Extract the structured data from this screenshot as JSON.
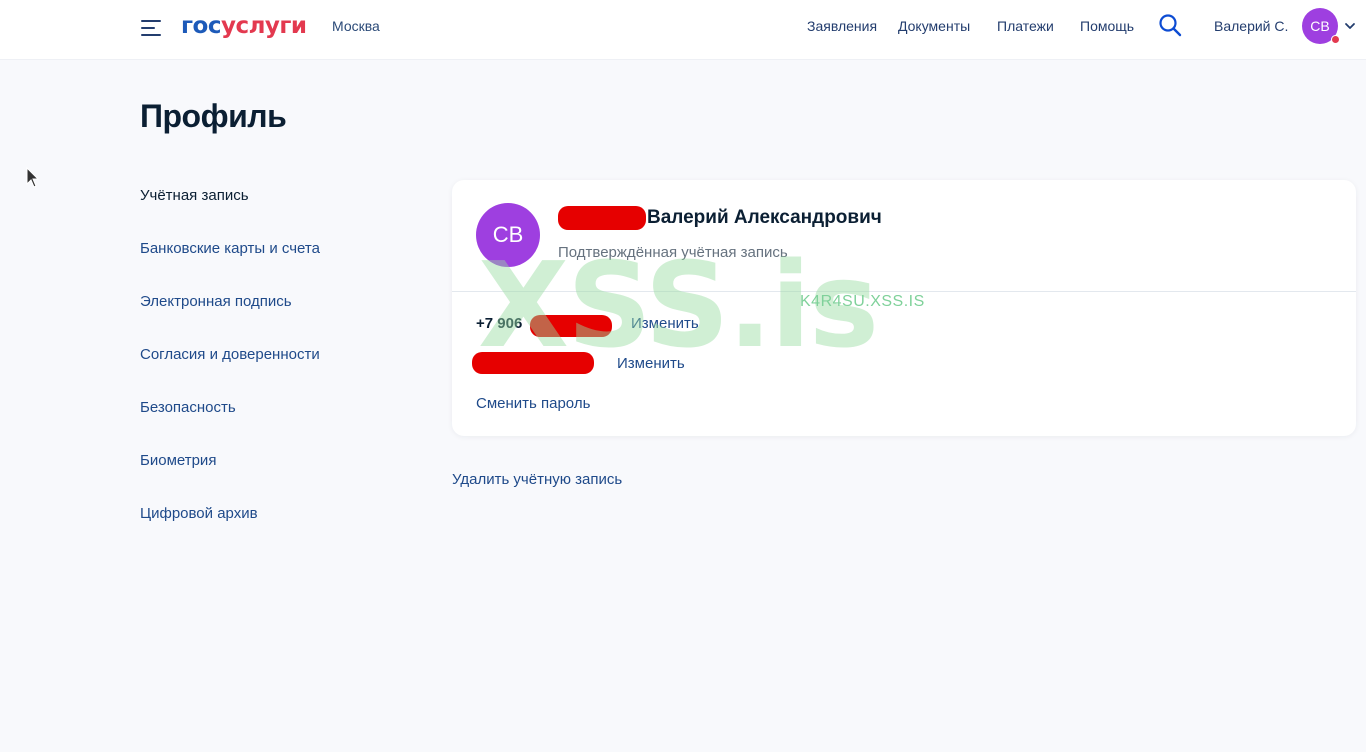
{
  "header": {
    "logo_part1": "гос",
    "logo_part2": "услуги",
    "city": "Москва",
    "nav": [
      "Заявления",
      "Документы",
      "Платежи",
      "Помощь"
    ],
    "user_name": "Валерий С.",
    "avatar_initials": "СВ"
  },
  "page": {
    "title": "Профиль"
  },
  "sidebar": {
    "items": [
      {
        "label": "Учётная запись",
        "active": true
      },
      {
        "label": "Банковские карты и счета"
      },
      {
        "label": "Электронная подпись"
      },
      {
        "label": "Согласия и доверенности"
      },
      {
        "label": "Безопасность"
      },
      {
        "label": "Биометрия"
      },
      {
        "label": "Цифровой архив"
      }
    ]
  },
  "profile": {
    "avatar_initials": "СВ",
    "name": "Валерий Александрович",
    "status": "Подтверждённая учётная запись",
    "phone": "+7 906",
    "change_phone": "Изменить",
    "change_email": "Изменить",
    "change_password": "Сменить пароль",
    "delete_account": "Удалить учётную запись"
  },
  "watermark": {
    "big": "XSS.is",
    "small": "K4R4SU.XSS.IS"
  },
  "colors": {
    "brand_blue": "#1d5ab9",
    "brand_red": "#e3394f",
    "avatar_purple": "#9e3fe0",
    "link": "#1f4a8a",
    "redaction": "#e60000"
  }
}
